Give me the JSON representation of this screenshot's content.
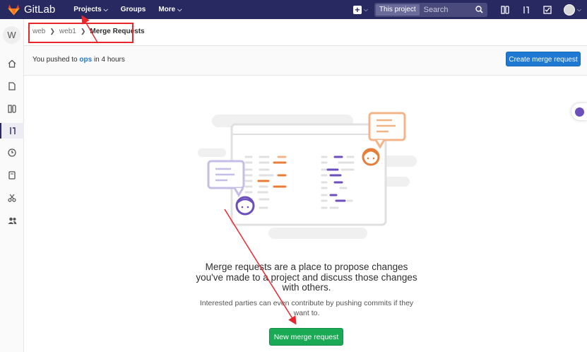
{
  "header": {
    "logo_text": "GitLab",
    "nav": [
      {
        "label": "Projects",
        "chevron": true
      },
      {
        "label": "Groups",
        "chevron": false
      },
      {
        "label": "More",
        "chevron": true
      }
    ],
    "search_scope": "This project",
    "search_placeholder": "Search"
  },
  "sidebar": {
    "project_initial": "W",
    "items": [
      "home-icon",
      "file-icon",
      "issues-icon",
      "merge-request-icon",
      "ci-icon",
      "wiki-icon",
      "snippets-icon",
      "members-icon"
    ]
  },
  "breadcrumb": {
    "items": [
      "web",
      "web1"
    ],
    "current": "Merge Requests"
  },
  "push_banner": {
    "prefix": "You pushed to",
    "branch": "ops",
    "suffix": "in 4 hours",
    "button": "Create merge request"
  },
  "empty_state": {
    "title": "Merge requests are a place to propose changes you've made to a project and discuss those changes with others.",
    "description": "Interested parties can even contribute by pushing commits if they want to.",
    "button": "New merge request"
  },
  "colors": {
    "nav_bg": "#292961",
    "primary": "#1f78d1",
    "success": "#1aaa55",
    "annotation": "#e8272c",
    "orange": "#e67e3a",
    "purple": "#6b4fbb"
  }
}
